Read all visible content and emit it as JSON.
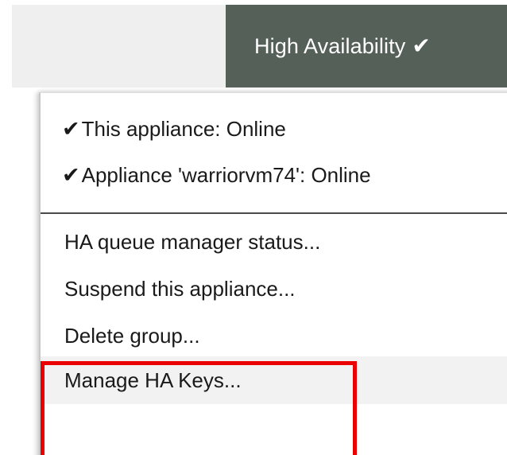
{
  "header": {
    "button_label": "High Availability",
    "button_icon": "check-icon"
  },
  "menu": {
    "status": [
      {
        "icon": "check-icon",
        "label": "This appliance: Online"
      },
      {
        "icon": "check-icon",
        "label": "Appliance 'warriorvm74': Online"
      }
    ],
    "actions": [
      {
        "label": "HA queue manager status..."
      },
      {
        "label": "Suspend this appliance..."
      },
      {
        "label": "Delete group..."
      },
      {
        "label": "Manage HA Keys..."
      }
    ]
  },
  "annotation": {
    "highlight_color": "#ea0000"
  },
  "colors": {
    "header_button_bg": "#556058",
    "top_bar_bg": "#efefef",
    "menu_hover_bg": "#f2f2f2"
  }
}
